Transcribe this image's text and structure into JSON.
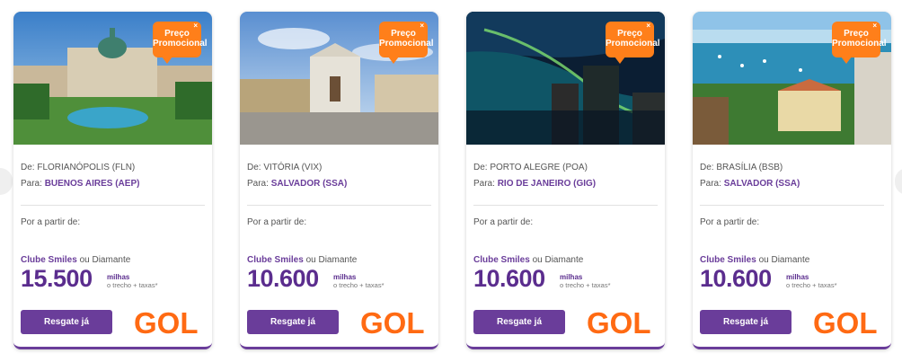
{
  "carousel": {
    "prev_label": "",
    "next_label": ""
  },
  "cards": [
    {
      "promo": "Preço Promocional",
      "promo_close": "×",
      "from_prefix": "De:",
      "from_city": "FLORIANÓPOLIS (FLN)",
      "to_prefix": "Para:",
      "to_city": "BUENOS AIRES (AEP)",
      "starting_from": "Por a partir de:",
      "club_brand": "Clube Smiles",
      "club_rest": " ou Diamante",
      "price": "15.500",
      "unit_miles": "milhas",
      "unit_note": "o trecho + taxas*",
      "button": "Resgate já",
      "airline": "GOL"
    },
    {
      "promo": "Preço Promocional",
      "promo_close": "×",
      "from_prefix": "De:",
      "from_city": "VITÓRIA (VIX)",
      "to_prefix": "Para:",
      "to_city": "SALVADOR (SSA)",
      "starting_from": "Por a partir de:",
      "club_brand": "Clube Smiles",
      "club_rest": " ou Diamante",
      "price": "10.600",
      "unit_miles": "milhas",
      "unit_note": "o trecho + taxas*",
      "button": "Resgate já",
      "airline": "GOL"
    },
    {
      "promo": "Preço Promocional",
      "promo_close": "×",
      "from_prefix": "De:",
      "from_city": "PORTO ALEGRE (POA)",
      "to_prefix": "Para:",
      "to_city": "RIO DE JANEIRO (GIG)",
      "starting_from": "Por a partir de:",
      "club_brand": "Clube Smiles",
      "club_rest": " ou Diamante",
      "price": "10.600",
      "unit_miles": "milhas",
      "unit_note": "o trecho + taxas*",
      "button": "Resgate já",
      "airline": "GOL"
    },
    {
      "promo": "Preço Promocional",
      "promo_close": "×",
      "from_prefix": "De:",
      "from_city": "BRASÍLIA (BSB)",
      "to_prefix": "Para:",
      "to_city": "SALVADOR (SSA)",
      "starting_from": "Por a partir de:",
      "club_brand": "Clube Smiles",
      "club_rest": " ou Diamante",
      "price": "10.600",
      "unit_miles": "milhas",
      "unit_note": "o trecho + taxas*",
      "button": "Resgate já",
      "airline": "GOL"
    }
  ],
  "colors": {
    "brand_purple": "#6a3d9a",
    "promo_orange": "#ff7f1a",
    "gol_orange": "#ff6a13"
  }
}
